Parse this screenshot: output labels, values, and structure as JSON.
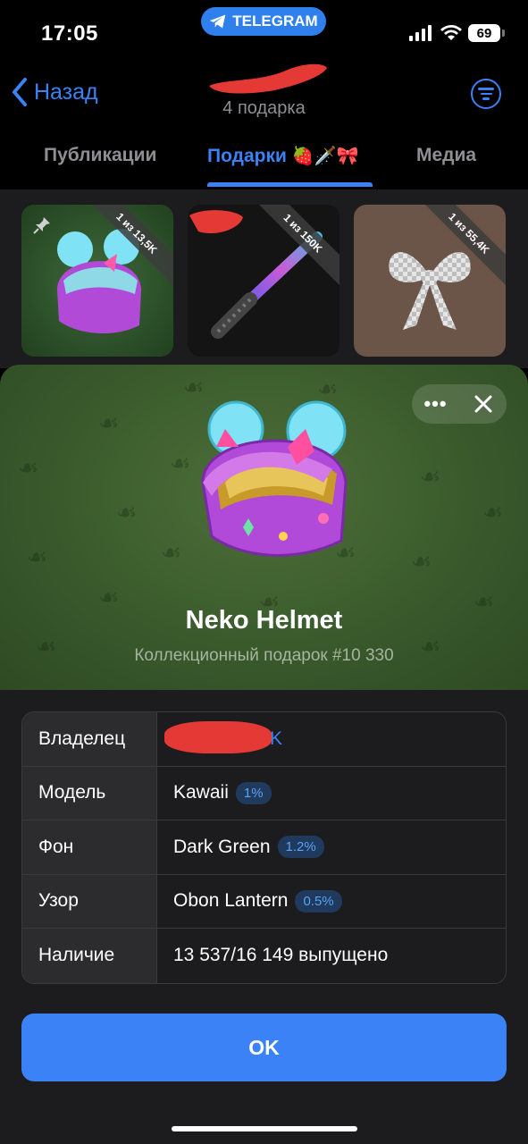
{
  "status": {
    "time": "17:05",
    "battery": "69",
    "pill_label": "TELEGRAM"
  },
  "nav": {
    "back_label": "Назад",
    "subtitle": "4 подарка"
  },
  "tabs": [
    {
      "label": "Публикации",
      "active": false
    },
    {
      "label": "Подарки",
      "active": true,
      "emojis": "🍓🗡️🎀"
    },
    {
      "label": "Медиа",
      "active": false
    }
  ],
  "gifts": [
    {
      "ribbon": "1 из 13,5K",
      "pinned": true
    },
    {
      "ribbon": "1 из 150K",
      "pinned": false
    },
    {
      "ribbon": "1 из 55,4K",
      "pinned": false
    }
  ],
  "detail": {
    "title": "Neko Helmet",
    "subtitle": "Коллекционный подарок #10 330",
    "rows": [
      {
        "key": "Владелец",
        "value": "K",
        "badge": ""
      },
      {
        "key": "Модель",
        "value": "Kawaii",
        "badge": "1%"
      },
      {
        "key": "Фон",
        "value": "Dark Green",
        "badge": "1.2%"
      },
      {
        "key": "Узор",
        "value": "Obon Lantern",
        "badge": "0.5%"
      },
      {
        "key": "Наличие",
        "value": "13 537/16 149 выпущено",
        "badge": ""
      }
    ],
    "ok_label": "OK"
  },
  "colors": {
    "accent": "#3b82f6",
    "background_green": "#3a5a2c",
    "redaction": "#e53935"
  }
}
